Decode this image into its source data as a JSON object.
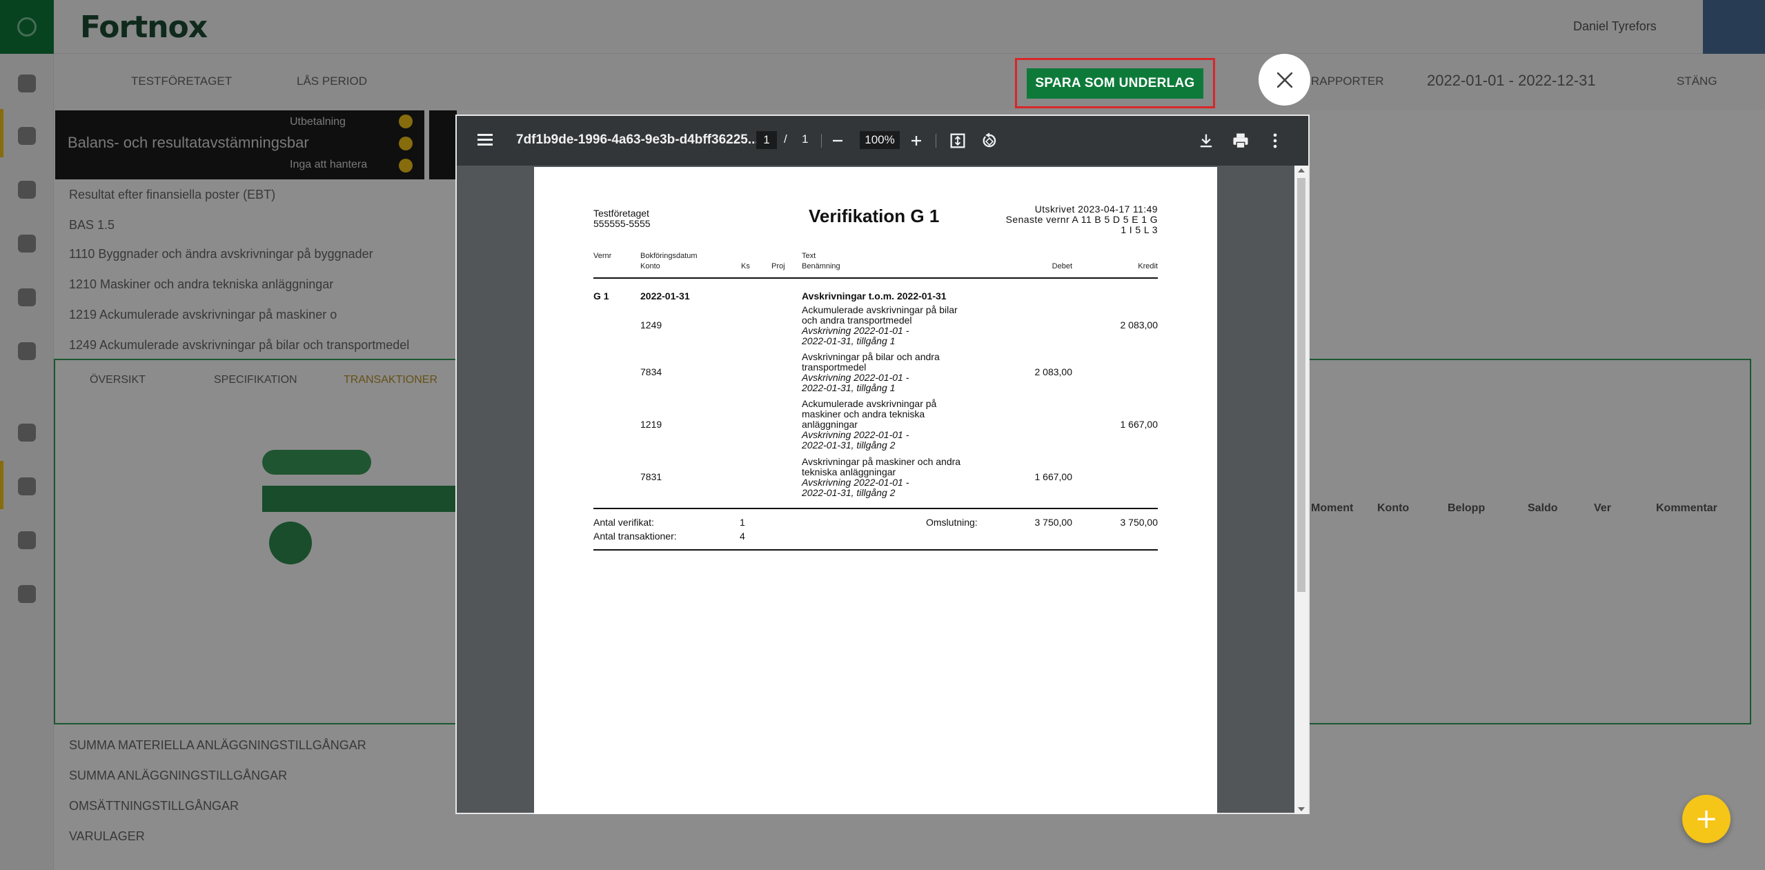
{
  "background": {
    "logo": "Fortnox",
    "user_label": "Daniel Tyrefors",
    "toolbar_items": [
      "TESTFÖRETAGET",
      "LÅS PERIOD",
      "RAPPORTER",
      "2022-01-01 - 2022-12-31",
      "STÄNG"
    ],
    "card_title": "Balans- och resultatavstämningsbar",
    "card_sub_1": "Utbetalning",
    "card_sub_2": "Inga att hantera",
    "lines": [
      "Resultat efter finansiella poster (EBT)",
      "BAS 1.5",
      "1110 Byggnader och ändra avskrivningar på byggnader",
      "1210 Maskiner och andra tekniska anläggningar",
      "1219 Ackumulerade avskrivningar på maskiner o",
      "1249 Ackumulerade avskrivningar på bilar och transportmedel"
    ],
    "tabs": [
      "ÖVERSIKT",
      "SPECIFIKATION",
      "TRANSAKTIONER"
    ],
    "table_headers": [
      "Moment",
      "Konto",
      "Belopp",
      "Saldo",
      "Ver",
      "Kommentar"
    ],
    "bottom_lines": [
      "SUMMA MATERIELLA ANLÄGGNINGSTILLGÅNGAR",
      "SUMMA ANLÄGGNINGSTILLGÅNGAR",
      "OMSÄTTNINGSTILLGÅNGAR",
      "VARULAGER"
    ]
  },
  "save_button": "SPARA SOM UNDERLAG",
  "viewer": {
    "filename": "7df1b9de-1996-4a63-9e3b-d4bff36225...",
    "page_current": "1",
    "page_separator": "/",
    "page_total": "1",
    "zoom": "100%"
  },
  "document": {
    "company": "Testföretaget",
    "org_number": "555555-5555",
    "title": "Verifikation G 1",
    "printed": "Utskrivet 2023-04-17 11:49",
    "latest_vernr_1": "Senaste vernr A 11 B 5 D 5 E 1 G",
    "latest_vernr_2": "1 I 5 L 3",
    "headers": {
      "vernr": "Vernr",
      "bokforingsdatum": "Bokföringsdatum",
      "konto": "Konto",
      "ks": "Ks",
      "proj": "Proj",
      "text": "Text",
      "benamning": "Benämning",
      "debet": "Debet",
      "kredit": "Kredit"
    },
    "voucher": {
      "vernr": "G 1",
      "date": "2022-01-31",
      "text": "Avskrivningar t.o.m. 2022-01-31"
    },
    "rows": [
      {
        "konto": "1249",
        "name_1": "Ackumulerade avskrivningar på bilar",
        "name_2": "och andra transportmedel",
        "note_1": "Avskrivning 2022-01-01 -",
        "note_2": "2022-01-31, tillgång 1",
        "debet": "",
        "kredit": "2 083,00"
      },
      {
        "konto": "7834",
        "name_1": "Avskrivningar på bilar och andra",
        "name_2": "transportmedel",
        "note_1": "Avskrivning 2022-01-01 -",
        "note_2": "2022-01-31, tillgång 1",
        "debet": "2 083,00",
        "kredit": ""
      },
      {
        "konto": "1219",
        "name_1": "Ackumulerade avskrivningar på",
        "name_2": "maskiner och andra tekniska",
        "name_3": "anläggningar",
        "note_1": "Avskrivning 2022-01-01 -",
        "note_2": "2022-01-31, tillgång 2",
        "debet": "",
        "kredit": "1 667,00"
      },
      {
        "konto": "7831",
        "name_1": "Avskrivningar på maskiner och andra",
        "name_2": "tekniska anläggningar",
        "note_1": "Avskrivning 2022-01-01 -",
        "note_2": "2022-01-31, tillgång 2",
        "debet": "1 667,00",
        "kredit": ""
      }
    ],
    "totals": {
      "antal_verifikat_label": "Antal verifikat:",
      "antal_verifikat": "1",
      "antal_transaktioner_label": "Antal transaktioner:",
      "antal_transaktioner": "4",
      "omslutning_label": "Omslutning:",
      "omslutning_debet": "3 750,00",
      "omslutning_kredit": "3 750,00"
    }
  },
  "fab_label": "+",
  "colors": {
    "primary_green": "#0e7a3a",
    "highlight_red": "#d8262a",
    "fab_yellow": "#f5c518",
    "viewer_toolbar": "#323639"
  }
}
